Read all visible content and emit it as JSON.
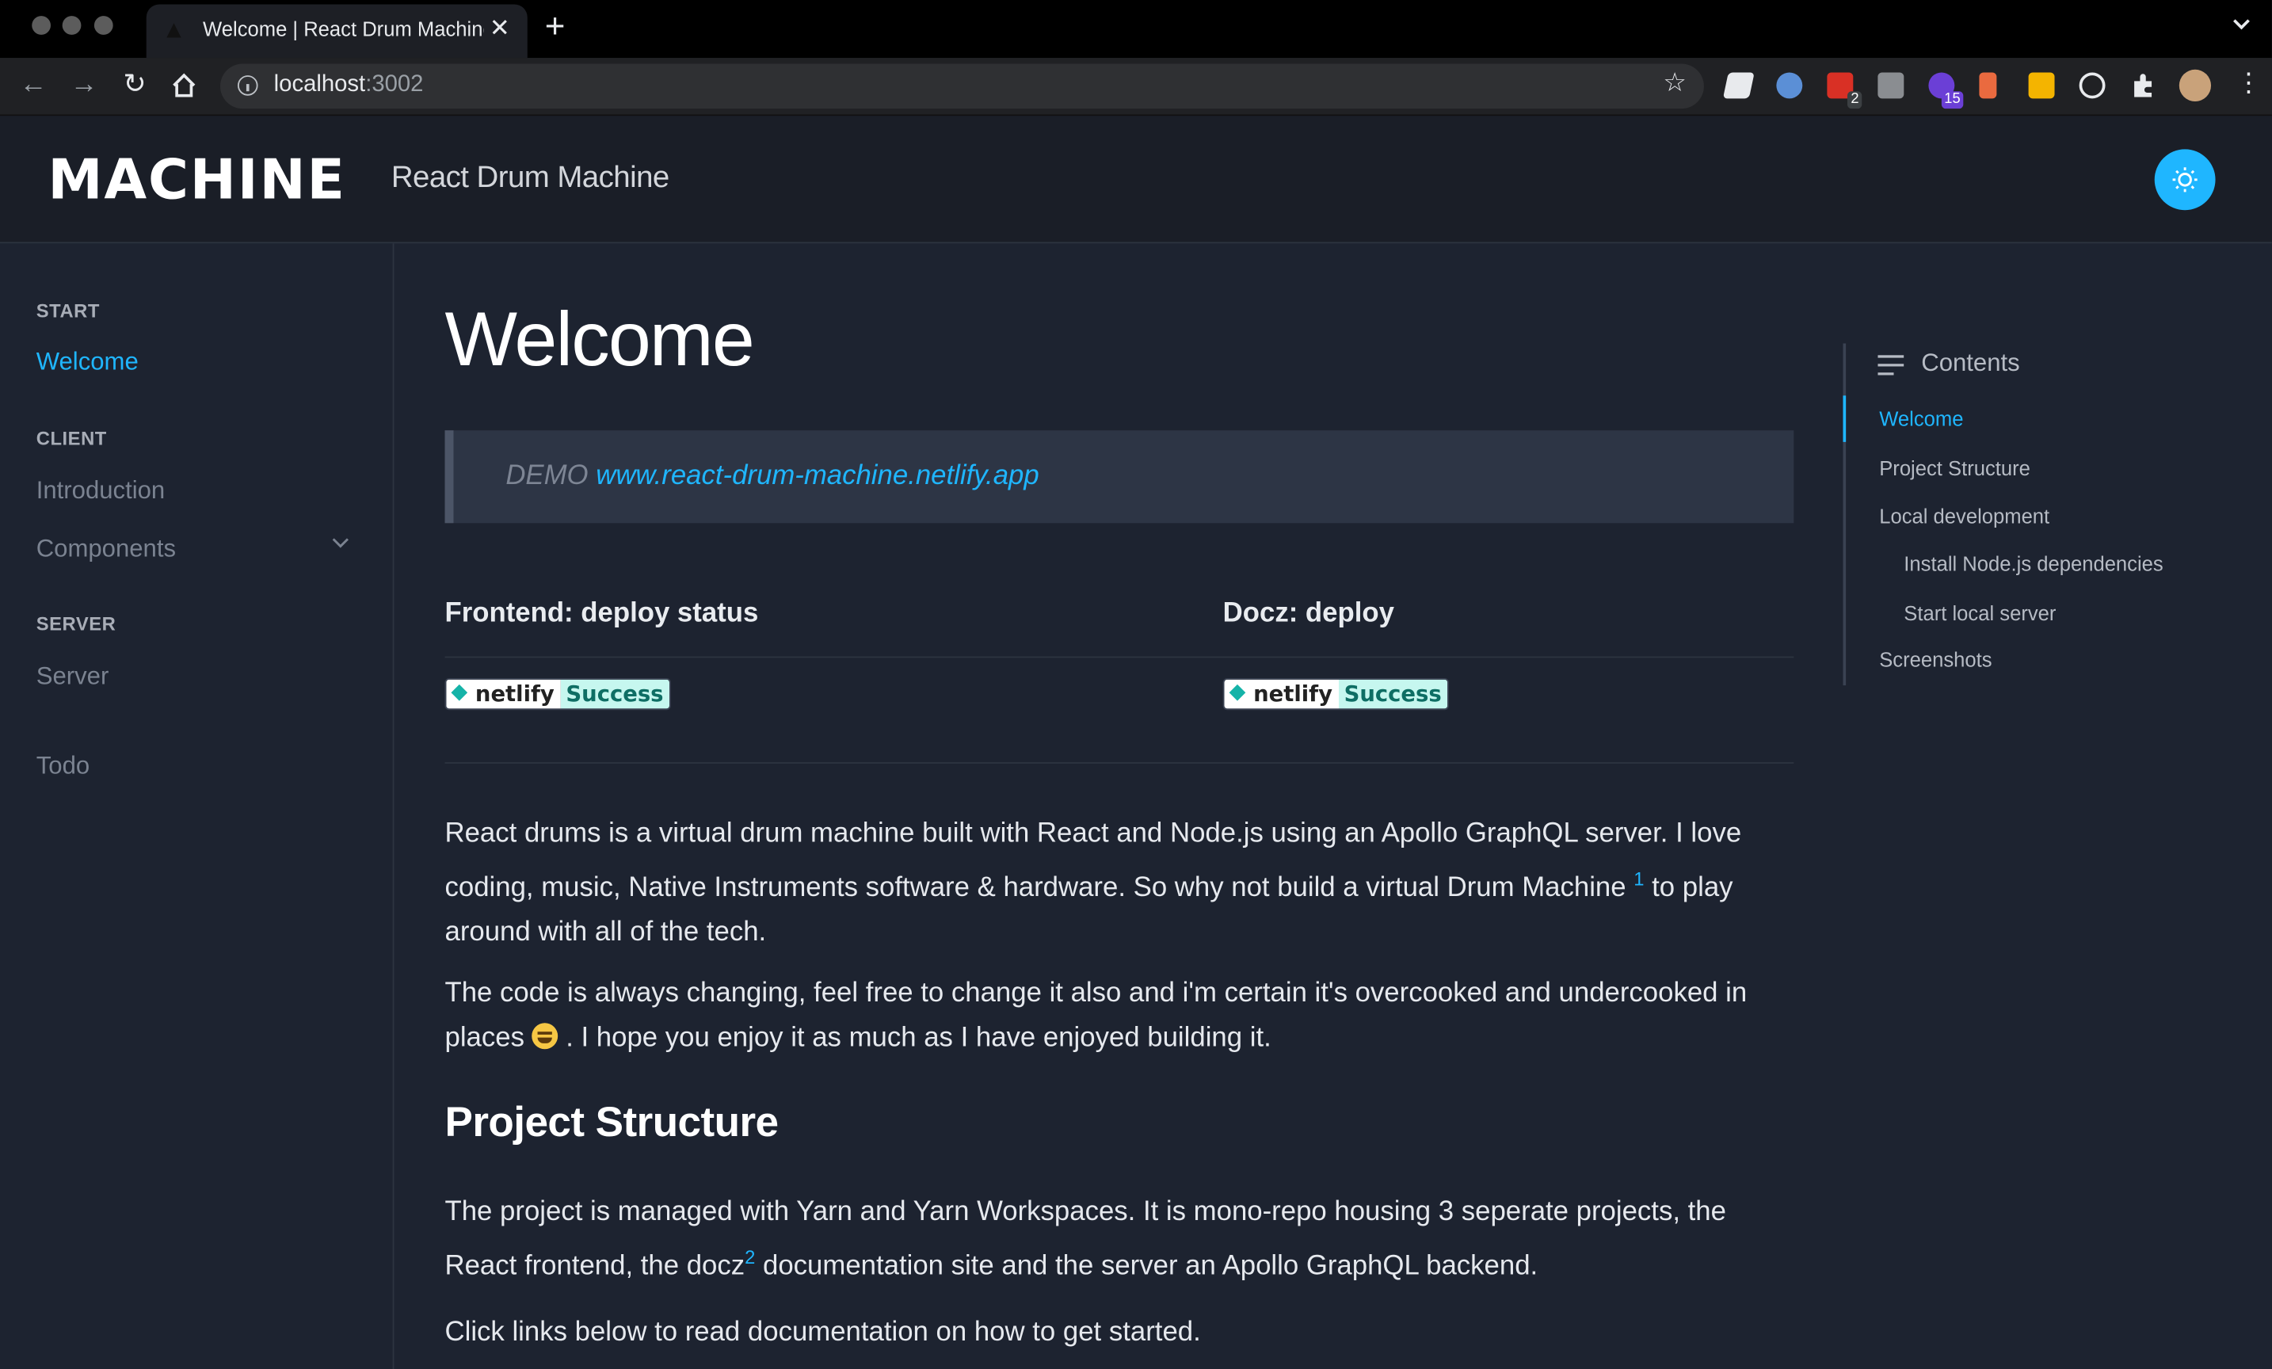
{
  "browser": {
    "tab_title": "Welcome | React Drum Machine",
    "url_host": "localhost",
    "url_port": ":3002",
    "extensions": [
      {
        "icon": "extension-red-icon",
        "badge": "2",
        "color": "#d93025"
      },
      {
        "icon": "extension-purple-icon",
        "badge": "15",
        "color": "#6b3fd6"
      }
    ]
  },
  "header": {
    "logo_text": "MACHINE",
    "site_name": "React Drum Machine",
    "theme_toggle_icon": "sun-icon",
    "accent_color": "#1fb6ff"
  },
  "sidebar": {
    "sections": [
      {
        "label": "START",
        "items": [
          {
            "label": "Welcome",
            "active": true
          }
        ]
      },
      {
        "label": "CLIENT",
        "items": [
          {
            "label": "Introduction"
          },
          {
            "label": "Components",
            "expandable": true
          }
        ]
      },
      {
        "label": "SERVER",
        "items": [
          {
            "label": "Server"
          }
        ]
      }
    ],
    "extra": {
      "label": "Todo"
    }
  },
  "main": {
    "title": "Welcome",
    "demo_prefix": "DEMO",
    "demo_link": "www.react-drum-machine.netlify.app",
    "deploy": [
      {
        "heading": "Frontend: deploy status",
        "badge_left": "netlify",
        "badge_right": "Success"
      },
      {
        "heading": "Docz: deploy",
        "badge_left": "netlify",
        "badge_right": "Success"
      }
    ],
    "intro_p1_a": "React drums is a virtual drum machine built with React and Node.js using an Apollo GraphQL server. I love coding, music, Native Instruments software & hardware. So why not build a virtual Drum Machine ",
    "intro_p1_sup": "1",
    "intro_p1_b": " to play around with all of the tech.",
    "intro_p2_a": "The code is always changing, feel free to change it also and i'm certain it's overcooked and undercooked in places ",
    "intro_p2_b": " . I hope you enjoy it as much as I have enjoyed building it.",
    "section_heading": "Project Structure",
    "struct_p1_a": "The project is managed with Yarn and Yarn Workspaces. It is mono-repo housing 3 seperate projects, the React frontend, the docz",
    "struct_p1_sup": "2",
    "struct_p1_b": " documentation site and the server an Apollo GraphQL backend.",
    "struct_p2": "Click links below to read documentation on how to get started."
  },
  "toc": {
    "heading": "Contents",
    "items": [
      {
        "label": "Welcome",
        "active": true
      },
      {
        "label": "Project Structure"
      },
      {
        "label": "Local development"
      },
      {
        "label": "Install Node.js dependencies",
        "indent": true
      },
      {
        "label": "Start local server",
        "indent": true
      },
      {
        "label": "Screenshots"
      }
    ]
  }
}
